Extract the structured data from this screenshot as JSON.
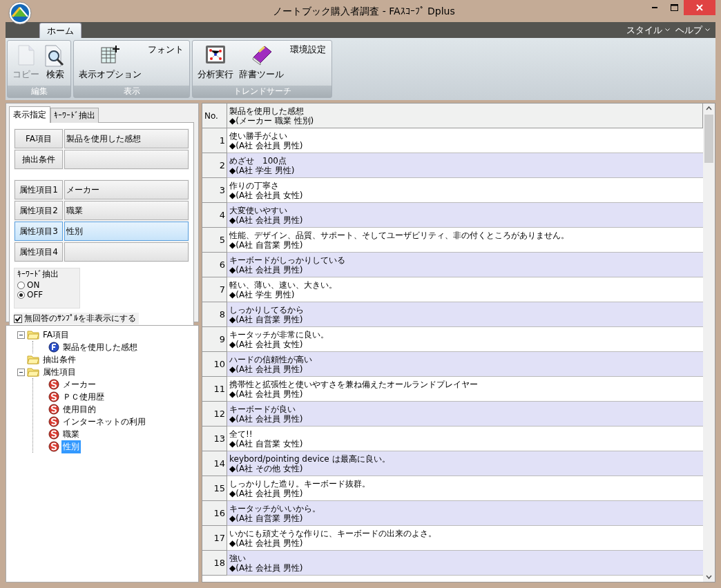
{
  "window": {
    "title": "ノートブック購入者調査 - FAｽｺｰﾌﾟ Dplus"
  },
  "ribbon": {
    "tabs": [
      {
        "label": "ホーム",
        "selected": true
      }
    ],
    "menus": [
      "スタイル",
      "ヘルプ"
    ],
    "groups": [
      {
        "label": "編集",
        "buttons": [
          {
            "kind": "large",
            "label": "コピー",
            "disabled": true
          },
          {
            "kind": "large",
            "label": "検索",
            "disabled": false
          }
        ]
      },
      {
        "label": "表示",
        "buttons": [
          {
            "kind": "large",
            "label": "表示オプション",
            "disabled": false
          },
          {
            "kind": "small",
            "label": "フォント",
            "disabled": false
          }
        ]
      },
      {
        "label": "トレンドサーチ",
        "buttons": [
          {
            "kind": "large",
            "label": "分析実行",
            "disabled": false
          },
          {
            "kind": "large",
            "label": "辞書ツール",
            "disabled": false
          },
          {
            "kind": "small",
            "label": "環境設定",
            "disabled": false
          }
        ]
      }
    ]
  },
  "left_panel": {
    "tabs": [
      {
        "label": "表示指定",
        "selected": true
      },
      {
        "label": "ｷｰﾜｰﾄﾞ抽出",
        "selected": false
      }
    ],
    "field_groups": [
      [
        {
          "label": "FA項目",
          "value": "製品を使用した感想",
          "selected": false
        },
        {
          "label": "抽出条件",
          "selected": false
        }
      ],
      [
        {
          "label": "属性項目1",
          "value": "メーカー",
          "selected": false
        },
        {
          "label": "属性項目2",
          "value": "職業",
          "selected": false
        },
        {
          "label": "属性項目3",
          "value": "性別",
          "selected": true
        },
        {
          "label": "属性項目4",
          "selected": false
        }
      ]
    ],
    "keyword_extract": {
      "title": "ｷｰﾜｰﾄﾞ抽出",
      "options": [
        {
          "label": "ON",
          "selected": false
        },
        {
          "label": "OFF",
          "selected": true
        }
      ]
    },
    "checkbox": {
      "label": "無回答のｻﾝﾌﾟﾙを非表示にする",
      "checked": true
    }
  },
  "tree": [
    {
      "label": "FA項目",
      "kind": "folder",
      "expanded": true,
      "selected": false,
      "children": [
        {
          "label": "製品を使用した感想",
          "kind": "fa",
          "selected": false
        }
      ]
    },
    {
      "label": "抽出条件",
      "kind": "folder",
      "selected": false
    },
    {
      "label": "属性項目",
      "kind": "folder",
      "expanded": true,
      "selected": false,
      "children": [
        {
          "label": "メーカー",
          "kind": "attribute",
          "selected": false
        },
        {
          "label": "ＰＣ使用歴",
          "kind": "attribute",
          "selected": false
        },
        {
          "label": "使用目的",
          "kind": "attribute",
          "selected": false
        },
        {
          "label": "インターネットの利用",
          "kind": "attribute",
          "selected": false
        },
        {
          "label": "職業",
          "kind": "attribute",
          "selected": false
        },
        {
          "label": "性別",
          "kind": "attribute",
          "selected": true
        }
      ]
    }
  ],
  "table": {
    "columns": {
      "no": "No.",
      "header": "製品を使用した感想",
      "header_sub": "◆(メーカー 職業 性別)"
    },
    "rows": [
      {
        "no": "1",
        "comment": "使い勝手がよい",
        "attributes": "◆(A社 会社員 男性)"
      },
      {
        "no": "2",
        "comment": "めざせ　100点",
        "attributes": "◆(A社 学生 男性)"
      },
      {
        "no": "3",
        "comment": "作りの丁寧さ",
        "attributes": "◆(A社 会社員 女性)"
      },
      {
        "no": "4",
        "comment": "大変使いやすい",
        "attributes": "◆(A社 会社員 男性)"
      },
      {
        "no": "5",
        "comment": "性能、デザイン、品質、サポート、そしてユーザビリティ、非の付くところがありません。",
        "attributes": "◆(A社 自営業 男性)"
      },
      {
        "no": "6",
        "comment": "キーボードがしっかりしている",
        "attributes": "◆(A社 会社員 男性)"
      },
      {
        "no": "7",
        "comment": "軽い、薄い、速い、大きい。",
        "attributes": "◆(A社 学生 男性)"
      },
      {
        "no": "8",
        "comment": "しっかりしてるから",
        "attributes": "◆(A社 自営業 男性)"
      },
      {
        "no": "9",
        "comment": "キータッチが非常に良い。",
        "attributes": "◆(A社 会社員 女性)"
      },
      {
        "no": "10",
        "comment": "ハードの信頼性が高い",
        "attributes": "◆(A社 会社員 男性)"
      },
      {
        "no": "11",
        "comment": "携帯性と拡張性と使いやすさを兼ね備えたオールランドプレイヤー",
        "attributes": "◆(A社 会社員 男性)"
      },
      {
        "no": "12",
        "comment": "キーボードが良い",
        "attributes": "◆(A社 会社員 男性)"
      },
      {
        "no": "13",
        "comment": "全て!!",
        "attributes": "◆(A社 自営業 女性)"
      },
      {
        "no": "14",
        "comment": "keybord/pointing device は最高に良い。",
        "attributes": "◆(A社 その他 女性)"
      },
      {
        "no": "15",
        "comment": "しっかりした造り。キーボード抜群。",
        "attributes": "◆(A社 会社員 男性)"
      },
      {
        "no": "16",
        "comment": "キータッチがいいから。",
        "attributes": "◆(A社 自営業 男性)"
      },
      {
        "no": "17",
        "comment": "いかにも頑丈そうな作りに、キーボードの出来のよさ。",
        "attributes": "◆(A社 会社員 男性)"
      },
      {
        "no": "18",
        "comment": "強い",
        "attributes": "◆(A社 会社員 男性)"
      }
    ]
  }
}
